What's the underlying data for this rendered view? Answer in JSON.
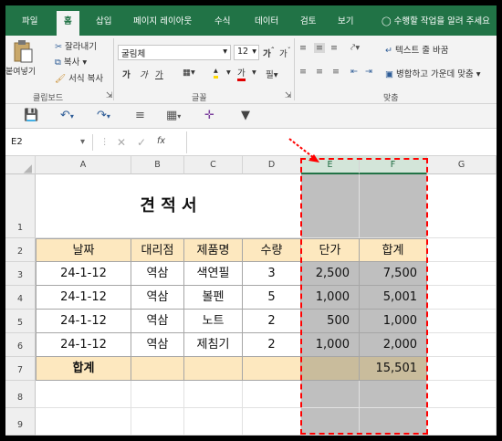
{
  "tabs": [
    "파일",
    "홈",
    "삽입",
    "페이지 레이아웃",
    "수식",
    "데이터",
    "검토",
    "보기"
  ],
  "tell_me": "수행할 작업을 알려 주세요",
  "clipboard": {
    "paste": "붙여넣기",
    "cut": "잘라내기",
    "copy": "복사",
    "format_painter": "서식 복사",
    "group": "클립보드"
  },
  "font": {
    "name": "굴림체",
    "size": "12",
    "bold": "가",
    "italic": "가",
    "underline": "가",
    "group": "글꼴"
  },
  "alignment": {
    "wrap": "텍스트 줄 바꿈",
    "merge": "병합하고 가운데 맞춤",
    "group": "맞춤"
  },
  "name_box": "E2",
  "formula_fx": "fx",
  "columns": [
    "A",
    "B",
    "C",
    "D",
    "E",
    "F",
    "G"
  ],
  "rows": [
    "1",
    "2",
    "3",
    "4",
    "5",
    "6",
    "7",
    "8",
    "9"
  ],
  "sheet": {
    "title": "견 적 서",
    "headers": [
      "날짜",
      "대리점",
      "제품명",
      "수량",
      "단가",
      "합계"
    ],
    "data": [
      [
        "24-1-12",
        "역삼",
        "색연필",
        "3",
        "2,500",
        "7,500"
      ],
      [
        "24-1-12",
        "역삼",
        "볼펜",
        "5",
        "1,000",
        "5,001"
      ],
      [
        "24-1-12",
        "역삼",
        "노트",
        "2",
        "500",
        "1,000"
      ],
      [
        "24-1-12",
        "역삼",
        "제침기",
        "2",
        "1,000",
        "2,000"
      ]
    ],
    "total_label": "합계",
    "total_value": "15,501"
  },
  "colors": {
    "accent": "#217346",
    "header_fill": "#fde8bf",
    "highlight_fill": "#bfbfbf",
    "annotation": "#ff0000"
  }
}
